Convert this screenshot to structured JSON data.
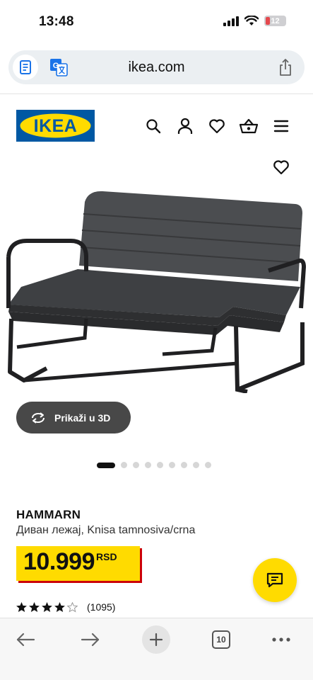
{
  "status_bar": {
    "time": "13:48",
    "battery": "12"
  },
  "browser": {
    "url": "ikea.com",
    "tabs_count": "10"
  },
  "header": {
    "logo_text": "IKEA"
  },
  "product": {
    "view_3d_label": "Prikaži u 3D",
    "name": "HAMMARN",
    "description": "Диван лежај, Knisa tamnosiva/crna",
    "price": "10.999",
    "currency": "RSD",
    "rating": 4,
    "rating_max": 5,
    "reviews": "(1095)",
    "image_dots": 9,
    "active_dot": 0
  },
  "colors": {
    "ikea_blue": "#0058a3",
    "ikea_yellow": "#ffdb00",
    "price_shadow": "#cc0008",
    "button_dark": "#484848"
  },
  "icons": {
    "header": [
      "search-icon",
      "profile-icon",
      "heart-icon",
      "basket-icon",
      "menu-icon"
    ],
    "toolbar": [
      "back-arrow-icon",
      "forward-arrow-icon",
      "plus-icon",
      "tabs-icon",
      "more-icon"
    ]
  }
}
